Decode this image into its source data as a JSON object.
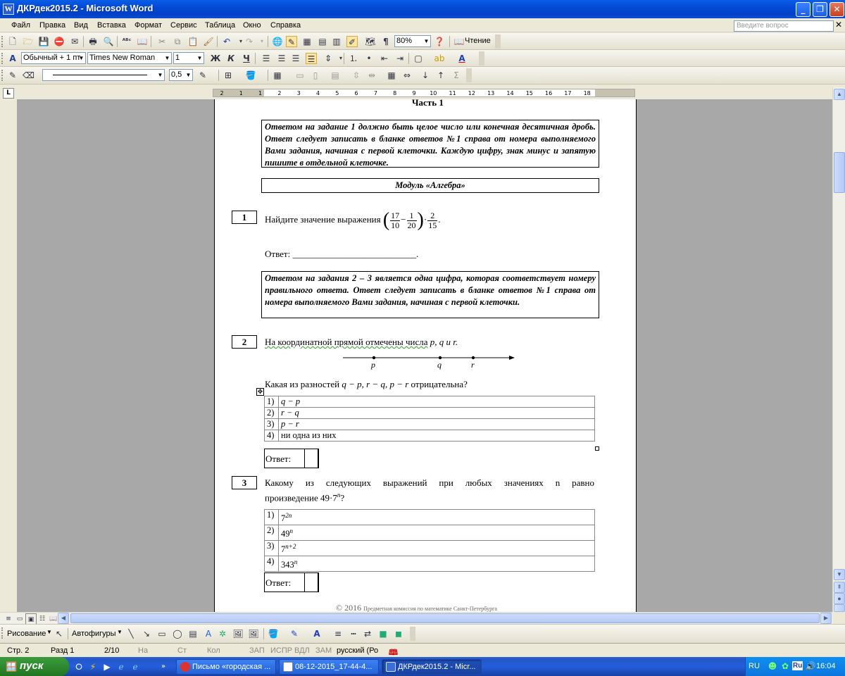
{
  "window": {
    "title": "ДКРдек2015.2 - Microsoft Word",
    "app_icon": "W"
  },
  "menu": [
    "Файл",
    "Правка",
    "Вид",
    "Вставка",
    "Формат",
    "Сервис",
    "Таблица",
    "Окно",
    "Справка"
  ],
  "ask_placeholder": "Введите вопрос",
  "toolbar": {
    "zoom": "80%",
    "read_label": "Чтение",
    "style": "Обычный + 1 пт",
    "font": "Times New Roman",
    "size": "1",
    "bold": "Ж",
    "italic": "К",
    "underline": "Ч",
    "line_weight": "0,5"
  },
  "ruler_numbers": [
    "2",
    "1",
    "1",
    "2",
    "3",
    "4",
    "5",
    "6",
    "7",
    "8",
    "9",
    "10",
    "11",
    "12",
    "13",
    "14",
    "15",
    "16",
    "17",
    "18"
  ],
  "document": {
    "part_heading": "Часть 1",
    "instr1": "Ответом на задание 1 должно быть целое число или конечная десятичная дробь. Ответ следует записать в бланке ответов №1 справа от номера выполняемого Вами задания, начиная с первой клеточки. Каждую цифру, знак минус и запятую пишите в отдельной клеточке.",
    "module": "Модуль «Алгебра»",
    "q1": {
      "num": "1",
      "text": "Найдите значение выражения",
      "f1n": "17",
      "f1d": "10",
      "minus": "−",
      "f2n": "1",
      "f2d": "20",
      "dot": "·",
      "f3n": "2",
      "f3d": "15",
      "end": "."
    },
    "answer_label": "Ответ:",
    "answer_line": "___________________________.",
    "instr2": "Ответом на задания 2 – 3 является одна цифра, которая соответствует номеру правильного ответа. Ответ следует записать в бланке ответов №1 справа от номера выполняемого Вами задания, начиная с первой клеточки.",
    "q2": {
      "num": "2",
      "text": "На координатной прямой отмечены числа",
      "vars": "p, q и r.",
      "points": [
        "p",
        "q",
        "r"
      ],
      "question": "Какая из разностей",
      "diffs": "q − p, r − q, p − r",
      "question_end": "отрицательна?",
      "options": [
        [
          "1)",
          "q − p"
        ],
        [
          "2)",
          "r − q"
        ],
        [
          "3)",
          "p − r"
        ],
        [
          "4)",
          "ни одна из них"
        ]
      ]
    },
    "q3": {
      "num": "3",
      "text_line1": "Какому из следующих выражений при любых значениях n равно",
      "text_line2": "произведение 49·7",
      "text_sup": "n",
      "text_end": "?",
      "options": [
        [
          "1)",
          "7",
          "2n"
        ],
        [
          "2)",
          "49",
          "n"
        ],
        [
          "3)",
          "7",
          "n+2"
        ],
        [
          "4)",
          "343",
          "n"
        ]
      ]
    },
    "footer": "© 2016",
    "footer_small": "Предметная комиссия по математике  Санкт-Петербурга"
  },
  "drawing": {
    "draw_label": "Рисование",
    "autoshapes_label": "Автофигуры"
  },
  "status": {
    "page": "Стр. 2",
    "section": "Разд 1",
    "pages": "2/10",
    "at": "На",
    "line": "Ст",
    "col": "Кол",
    "rec": "ЗАП",
    "trk": "ИСПР",
    "ext": "ВДЛ",
    "ovr": "ЗАМ",
    "lang": "русский (Ро"
  },
  "taskbar": {
    "start": "пуск",
    "tasks": [
      "Письмо «городская ...",
      "08-12-2015_17-44-4...",
      "ДКРдек2015.2 - Micr..."
    ],
    "lang": "RU",
    "clock": "16:04",
    "kb": "Ru"
  },
  "colors": {
    "titlebar": "#0349d6",
    "start": "#2f8a2f",
    "workspace": "#a8a8a8"
  }
}
